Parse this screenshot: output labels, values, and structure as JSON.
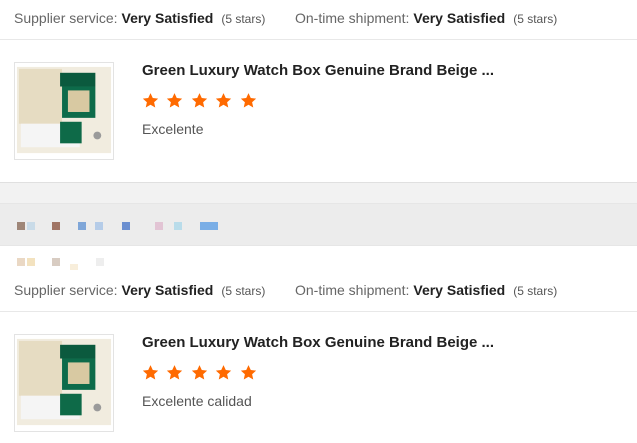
{
  "review1": {
    "supplier_label": "Supplier service:",
    "supplier_value": "Very Satisfied",
    "supplier_stars": "(5 stars)",
    "shipment_label": "On-time shipment:",
    "shipment_value": "Very Satisfied",
    "shipment_stars": "(5 stars)",
    "product_title": "Green Luxury Watch Box Genuine Brand Beige ...",
    "rating": 5,
    "comment": "Excelente"
  },
  "review2": {
    "supplier_label": "Supplier service:",
    "supplier_value": "Very Satisfied",
    "supplier_stars": "(5 stars)",
    "shipment_label": "On-time shipment:",
    "shipment_value": "Very Satisfied",
    "shipment_stars": "(5 stars)",
    "product_title": "Green Luxury Watch Box Genuine Brand Beige ...",
    "rating": 5,
    "comment": "Excelente calidad"
  },
  "colors": {
    "star": "#ff6a00",
    "box_green": "#0d6b4a",
    "box_beige": "#e9dfc6"
  },
  "icons": {
    "star": "star-icon",
    "product_image": "watch-box-image"
  }
}
